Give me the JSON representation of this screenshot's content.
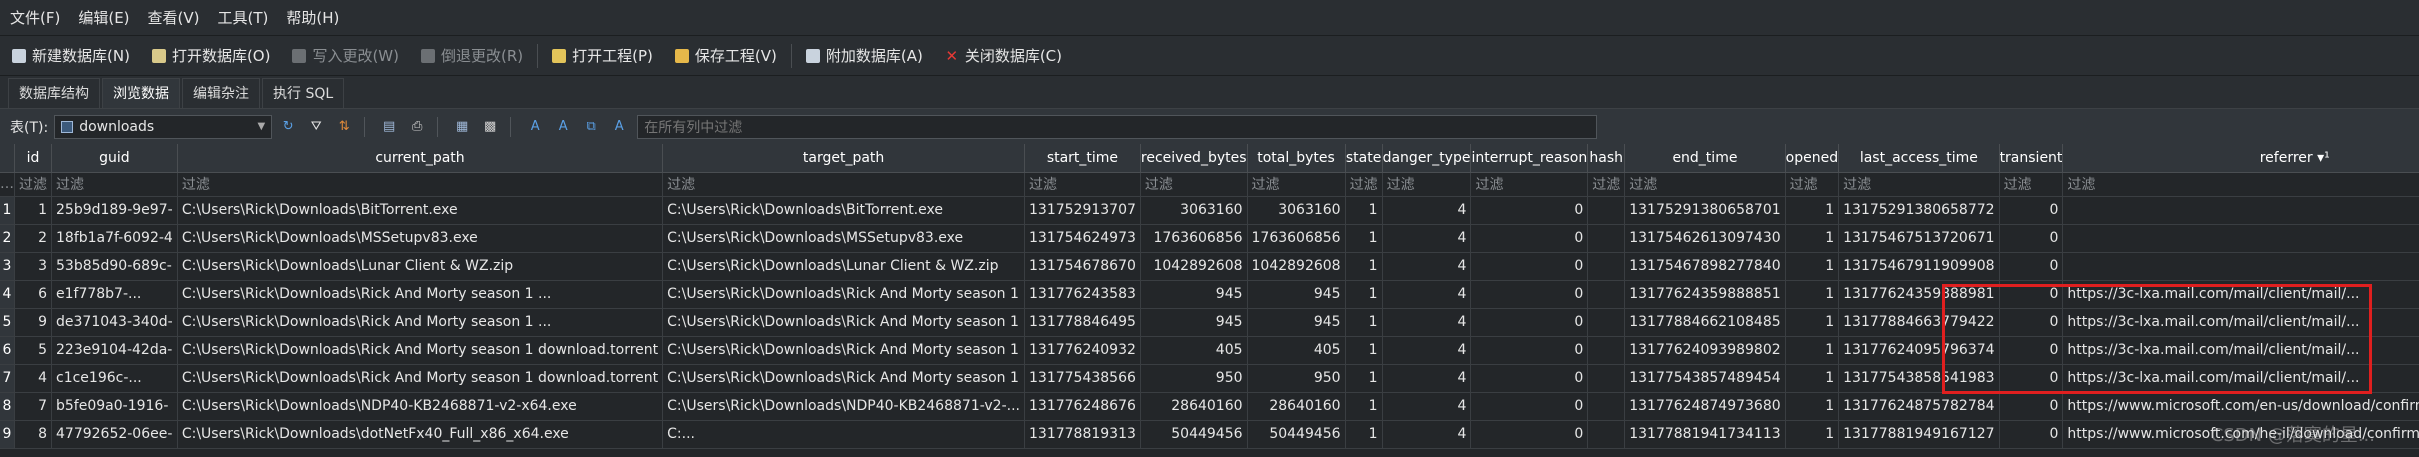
{
  "menu": [
    "文件(F)",
    "编辑(E)",
    "查看(V)",
    "工具(T)",
    "帮助(H)"
  ],
  "toolbar": [
    {
      "label": "新建数据库(N)",
      "icon": "new-db-icon",
      "disabled": false
    },
    {
      "label": "打开数据库(O)",
      "icon": "open-db-icon",
      "disabled": false
    },
    {
      "label": "写入更改(W)",
      "icon": "write-changes-icon",
      "disabled": true
    },
    {
      "label": "倒退更改(R)",
      "icon": "revert-changes-icon",
      "disabled": true
    },
    {
      "label": "打开工程(P)",
      "icon": "open-project-icon",
      "disabled": false
    },
    {
      "label": "保存工程(V)",
      "icon": "save-project-icon",
      "disabled": false
    },
    {
      "label": "附加数据库(A)",
      "icon": "attach-db-icon",
      "disabled": false
    },
    {
      "label": "关闭数据库(C)",
      "icon": "close-db-icon",
      "disabled": false
    }
  ],
  "tabs": [
    "数据库结构",
    "浏览数据",
    "编辑杂注",
    "执行 SQL"
  ],
  "active_tab": 1,
  "filterbar": {
    "table_label": "表(T):",
    "table_value": "downloads",
    "global_filter_placeholder": "在所有列中过滤"
  },
  "columns": [
    "id",
    "guid",
    "current_path",
    "target_path",
    "start_time",
    "received_bytes",
    "total_bytes",
    "state",
    "danger_type",
    "interrupt_reason",
    "hash",
    "end_time",
    "opened",
    "last_access_time",
    "transient",
    "referrer ▾¹"
  ],
  "filter_placeholder": "过滤",
  "rows": [
    [
      "1",
      "1",
      "25b9d189-9e97-",
      "C:\\Users\\Rick\\Downloads\\BitTorrent.exe",
      "C:\\Users\\Rick\\Downloads\\BitTorrent.exe",
      "131752913707",
      "3063160",
      "3063160",
      "1",
      "4",
      "0",
      "",
      "131752913806587​01",
      "1",
      "13175291380658772",
      "0",
      ""
    ],
    [
      "2",
      "2",
      "18fb1a7f-6092-4",
      "C:\\Users\\Rick\\Downloads\\MSSetupv83.exe",
      "C:\\Users\\Rick\\Downloads\\MSSetupv83.exe",
      "131754624973",
      "1763606856",
      "1763606856",
      "1",
      "4",
      "0",
      "",
      "13175462613097430",
      "1",
      "13175467513720671",
      "0",
      ""
    ],
    [
      "3",
      "3",
      "53b85d90-689c-",
      "C:\\Users\\Rick\\Downloads\\Lunar Client & WZ.zip",
      "C:\\Users\\Rick\\Downloads\\Lunar Client & WZ.zip",
      "131754678670",
      "1042892608",
      "1042892608",
      "1",
      "4",
      "0",
      "",
      "13175467898277840",
      "1",
      "13175467911909908",
      "0",
      ""
    ],
    [
      "4",
      "6",
      "e1f778b7-...",
      "C:\\Users\\Rick\\Downloads\\Rick And Morty season 1 ...",
      "C:\\Users\\Rick\\Downloads\\Rick And Morty season 1",
      "131776243583",
      "945",
      "945",
      "1",
      "4",
      "0",
      "",
      "13177624359888851",
      "1",
      "13177624359888981",
      "0",
      "https://3c-lxa.mail.com/mail/client/mail/..."
    ],
    [
      "5",
      "9",
      "de371043-340d-",
      "C:\\Users\\Rick\\Downloads\\Rick And Morty season 1 ...",
      "C:\\Users\\Rick\\Downloads\\Rick And Morty season 1",
      "131778846495",
      "945",
      "945",
      "1",
      "4",
      "0",
      "",
      "13177884662108485",
      "1",
      "13177884663779422",
      "0",
      "https://3c-lxa.mail.com/mail/client/mail/..."
    ],
    [
      "6",
      "5",
      "223e9104-42da-",
      "C:\\Users\\Rick\\Downloads\\Rick And Morty season 1 download.torrent",
      "C:\\Users\\Rick\\Downloads\\Rick And Morty season 1",
      "131776240932",
      "405",
      "405",
      "1",
      "4",
      "0",
      "",
      "13177624093989802",
      "1",
      "13177624095796374",
      "0",
      "https://3c-lxa.mail.com/mail/client/mail/..."
    ],
    [
      "7",
      "4",
      "c1ce196c-...",
      "C:\\Users\\Rick\\Downloads\\Rick And Morty season 1 download.torrent",
      "C:\\Users\\Rick\\Downloads\\Rick And Morty season 1",
      "131775438566",
      "950",
      "950",
      "1",
      "4",
      "0",
      "",
      "13177543857489454",
      "1",
      "13177543858541983",
      "0",
      "https://3c-lxa.mail.com/mail/client/mail/..."
    ],
    [
      "8",
      "7",
      "b5fe09a0-1916-",
      "C:\\Users\\Rick\\Downloads\\NDP40-KB2468871-v2-x64.exe",
      "C:\\Users\\Rick\\Downloads\\NDP40-KB2468871-v2-...",
      "131776248676",
      "28640160",
      "28640160",
      "1",
      "4",
      "0",
      "",
      "13177624874973680",
      "1",
      "13177624875782784",
      "0",
      "https://www.microsoft.com/en-us/download/confirmation.aspx?..."
    ],
    [
      "9",
      "8",
      "47792652-06ee-",
      "C:\\Users\\Rick\\Downloads\\dotNetFx40_Full_x86_x64.exe",
      "C:...",
      "131778819313",
      "50449456",
      "50449456",
      "1",
      "4",
      "0",
      "",
      "13177881941734113",
      "1",
      "13177881949167127",
      "0",
      "https://www.microsoft.com/he-il/download/confirmation.aspx?..."
    ]
  ],
  "watermark": "CSDN @落寞的星..."
}
